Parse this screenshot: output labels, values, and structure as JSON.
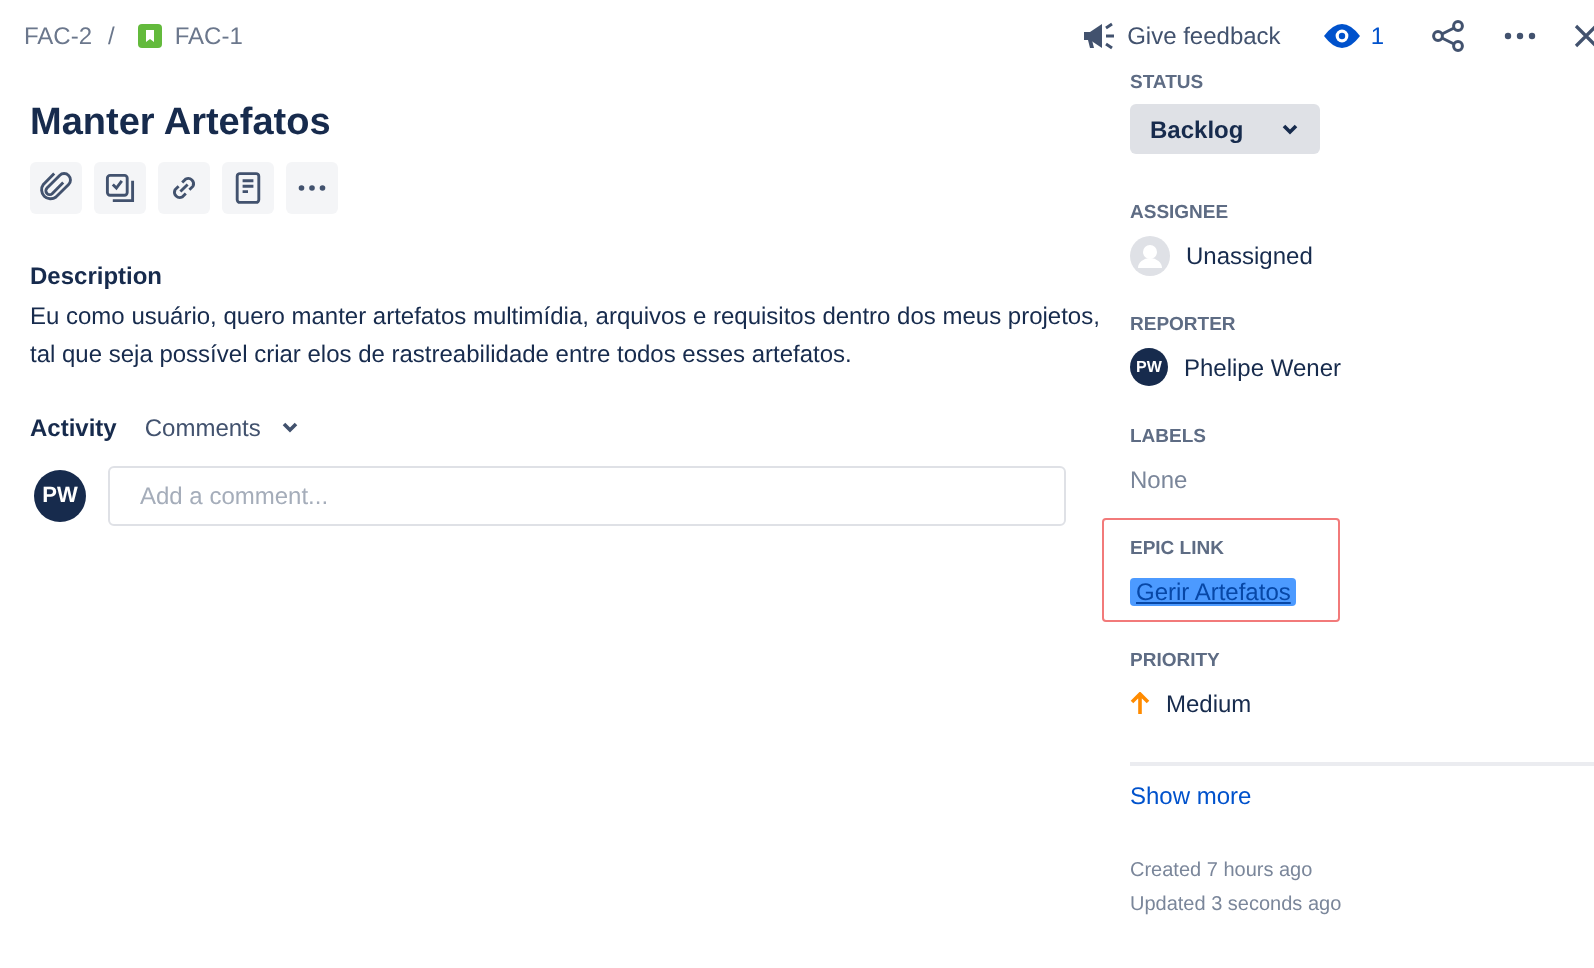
{
  "breadcrumbs": [
    {
      "label": "FAC-2",
      "kind": "parent"
    },
    {
      "label": "FAC-1",
      "kind": "story"
    }
  ],
  "breadcrumb_separator": "/",
  "header_actions": {
    "feedback": "Give feedback",
    "watchers": "1"
  },
  "title": "Manter Artefatos",
  "toolbar": [
    {
      "kind": "attach"
    },
    {
      "kind": "subtask"
    },
    {
      "kind": "link"
    },
    {
      "kind": "page"
    },
    {
      "kind": "more"
    }
  ],
  "description": {
    "heading": "Description",
    "lines": [
      "Eu como usuário, quero manter artefatos multimídia, arquivos e requisitos dentro dos meus projetos,",
      "tal que seja possível criar elos de rastreabilidade entre todos esses artefatos."
    ]
  },
  "activity": {
    "heading": "Activity",
    "filter": "Comments",
    "avatar": "PW",
    "placeholder": "Add a comment..."
  },
  "fields": [
    {
      "label": "STATUS",
      "kind": "status",
      "value": "Backlog"
    },
    {
      "label": "ASSIGNEE",
      "kind": "empty-user",
      "value": "Unassigned"
    },
    {
      "label": "REPORTER",
      "kind": "user",
      "avatar": "PW",
      "value": "Phelipe Wener"
    },
    {
      "label": "LABELS",
      "kind": "none",
      "value": "None"
    },
    {
      "label": "EPIC LINK",
      "kind": "link",
      "value": "Gerir Artefatos",
      "highlighted": true
    },
    {
      "label": "PRIORITY",
      "kind": "priority",
      "value": "Medium"
    }
  ],
  "show_more": "Show more",
  "timestamps": [
    "Created 7 hours ago",
    "Updated 3 seconds ago"
  ]
}
